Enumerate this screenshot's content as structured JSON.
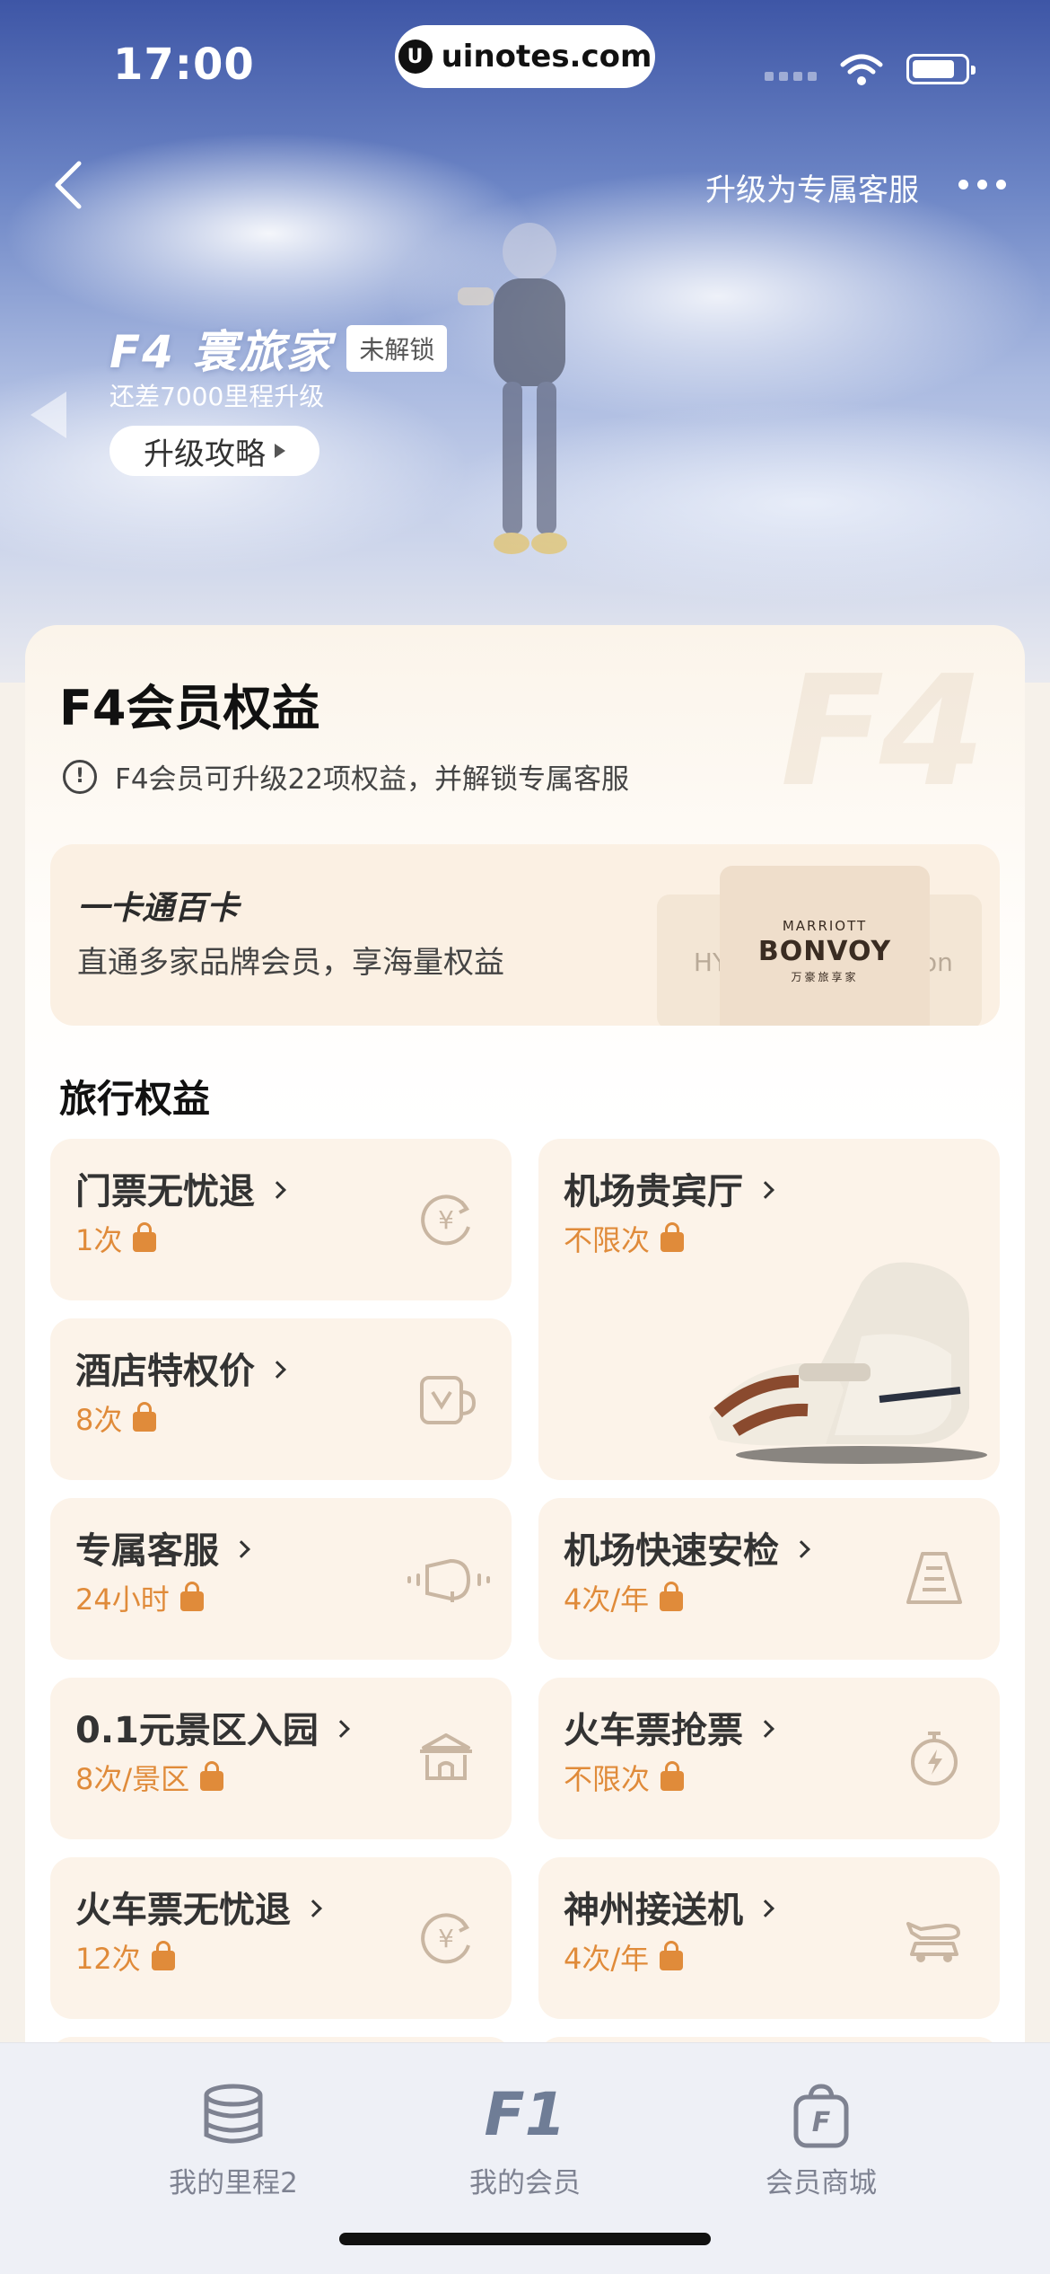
{
  "status_bar": {
    "time": "17:00",
    "site": "uinotes.com"
  },
  "header": {
    "upgrade_service_label": "升级为专属客服"
  },
  "tier": {
    "title": "F4 寰旅家",
    "locked_badge": "未解锁",
    "subtitle": "还差7000里程升级",
    "guide_label": "升级攻略"
  },
  "card": {
    "watermark": "F4",
    "title": "F4会员权益",
    "note": "F4会员可升级22项权益，并解锁专属客服"
  },
  "onecard": {
    "title": "一卡通百卡",
    "subtitle": "直通多家品牌会员，享海量权益",
    "brands": {
      "left": "HY",
      "main_top": "MARRIOTT",
      "main": "BONVOY",
      "main_bottom": "万豪旅享家",
      "right": "ton"
    }
  },
  "section": {
    "title": "旅行权益"
  },
  "perks": [
    {
      "name": "门票无忧退",
      "value": "1次",
      "icon": "yen-refund-icon"
    },
    {
      "name": "机场贵宾厅",
      "value": "不限次",
      "icon": "massage-chair-image"
    },
    {
      "name": "酒店特权价",
      "value": "8次",
      "icon": "hotel-cup-icon"
    },
    {
      "name": "专属客服",
      "value": "24小时",
      "icon": "headset-icon"
    },
    {
      "name": "机场快速安检",
      "value": "4次/年",
      "icon": "security-gate-icon"
    },
    {
      "name": "0.1元景区入园",
      "value": "8次/景区",
      "icon": "scenic-gate-icon"
    },
    {
      "name": "火车票抢票",
      "value": "不限次",
      "icon": "stopwatch-bolt-icon"
    },
    {
      "name": "火车票无忧退",
      "value": "12次",
      "icon": "yen-refund-icon"
    },
    {
      "name": "神州接送机",
      "value": "4次/年",
      "icon": "car-plane-icon"
    }
  ],
  "tabbar": {
    "tabs": [
      {
        "label": "我的里程2",
        "icon": "coins-stack-icon"
      },
      {
        "label": "我的会员",
        "icon_text": "F1"
      },
      {
        "label": "会员商城",
        "icon": "shopping-bag-f-icon",
        "icon_text": "F"
      }
    ]
  },
  "colors": {
    "accent": "#e08b3a",
    "perk_bg": "#fcf3e9",
    "hero_top": "#3e56a6"
  }
}
